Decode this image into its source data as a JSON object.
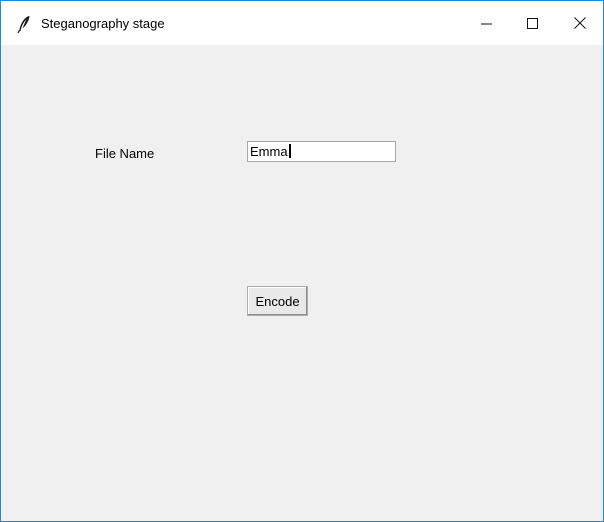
{
  "window": {
    "title": "Steganography stage",
    "icon": "feather-icon",
    "accent_color": "#1c8ad6",
    "controls": {
      "minimize": "minimize-icon",
      "maximize": "maximize-icon",
      "close": "close-icon"
    }
  },
  "form": {
    "file_name_label": "File Name",
    "file_name_value": "Emma",
    "encode_label": "Encode"
  }
}
